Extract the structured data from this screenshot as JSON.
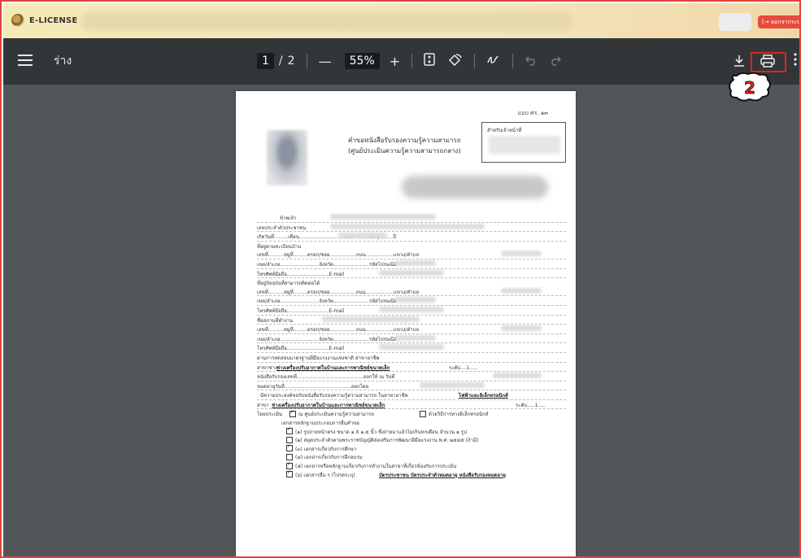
{
  "app": {
    "brand": "E-LICENSE",
    "logout_label": "[→ ออกจากระบบ"
  },
  "toolbar": {
    "doc_title": "ร่าง",
    "current_page": "1",
    "page_separator": "/",
    "total_pages": "2",
    "zoom_out": "—",
    "zoom_level": "55%",
    "zoom_in": "+",
    "icons": [
      "menu-icon",
      "fit-page-icon",
      "rotate-icon",
      "annotate-icon",
      "undo-icon",
      "redo-icon",
      "download-icon",
      "print-icon",
      "more-icon"
    ]
  },
  "annotation": {
    "step_number": "2",
    "highlight_color": "#e0231c"
  },
  "document": {
    "form_ref": "แบบ ศร. ๑๓",
    "heading_line1": "คำขอหนังสือรับรองความรู้ความสามารถ",
    "heading_line2": "(ศูนย์ประเมินความรู้ความสามารถกลาง)",
    "staff_box_label": "สำหรับเจ้าหน้าที่",
    "rows": [
      "ข้าพเจ้า",
      "เลขประจำตัวประชาชน",
      "เกิดวันที่.........เดือน..............................พ.ศ. .........อายุ.........ปี",
      "ที่อยู่ตามทะเบียนบ้าน",
      "เลขที่..........หมู่ที่.........ตรอก/ซอย.................ถนน..................แขวง/ตำบล",
      "เขต/อำเภอ.........................จังหวัด.......................รหัสไปรษณีย์",
      "โทรศัพท์มือถือ...........................E-mail",
      "ที่อยู่ปัจจุบันที่สามารถติดต่อได้",
      "เลขที่..........หมู่ที่.........ตรอก/ซอย.................ถนน..................แขวง/ตำบล",
      "เขต/อำเภอ.........................จังหวัด.......................รหัสไปรษณีย์",
      "โทรศัพท์มือถือ...........................E-mail",
      "ชื่อสถานที่ทำงาน",
      "เลขที่..........หมู่ที่.........ตรอก/ซอย.................ถนน..................แขวง/ตำบล",
      "เขต/อำเภอ.........................จังหวัด.......................รหัสไปรษณีย์",
      "โทรศัพท์มือถือ...........................E-mail",
      "ผ่านการทดสอบมาตรฐานฝีมือแรงงานแห่งชาติ สาขาอาชีพ"
    ],
    "branch_prefix": "สาขาช่าง",
    "branch_value": "ช่างเครื่องปรับอากาศในบ้านและการพาณิชย์ขนาดเล็ก",
    "branch_level": "ระดับ....1.....",
    "cert_row": "หนังสือรับรองเลขที่...........................................ออกให้ ณ วันที่",
    "expire_row": "หมดอายุวันที่...........................................ออกโดย",
    "purpose_prefix": "มีความประสงค์ขอรับหนังสือรับรองความรู้ความสามารถ ในสาขาอาชีพ",
    "purpose_value": "ไฟฟ้าและอิเล็กทรอนิกส์",
    "purpose_branch_prefix": "สาขา",
    "purpose_branch_value": "ช่างเครื่องปรับอากาศในบ้านและการพาณิชย์ขนาดเล็ก",
    "purpose_level": "ระดับ.....1.....",
    "method_prefix": "โดยประเมิน",
    "method_center": "ณ ศูนย์ประเมินความรู้ความสามารถ",
    "method_electronic": "ด้วยวิธีการทางอิเล็กทรอนิกส์",
    "attachments_title": "เอกสารหลักฐานประกอบการยื่นคำขอ",
    "attachments": [
      {
        "checked": true,
        "text": "(๑) รูปถ่ายหน้าตรง ขนาด ๑ X ๑.๕ นิ้ว ซึ่งถ่ายมาแล้วไม่เกินหกเดือน จำนวน ๑ รูป"
      },
      {
        "checked": false,
        "text": "(๒) สมุดประจำตัวตามพระราชบัญญัติส่งเสริมการพัฒนาฝีมือแรงงาน พ.ศ. ๒๕๔๕ (ถ้ามี)"
      },
      {
        "checked": true,
        "text": "(๓) เอกสารเกี่ยวกับการศึกษา"
      },
      {
        "checked": false,
        "text": "(๔) เอกสารเกี่ยวกับการฝึกอบรม"
      },
      {
        "checked": true,
        "text": "(๕) เอกสารหรือหลักฐานเกี่ยวกับการทำงานในสาขาที่เกี่ยวข้องกับการประเมิน"
      }
    ],
    "other_prefix": "(๖) เอกสารอื่น ๆ (โปรดระบุ)",
    "other_value": "บัตรประชาชน บัตรประจำตัวหมดอายุ หนังสือรับรองหมดอายุ"
  }
}
